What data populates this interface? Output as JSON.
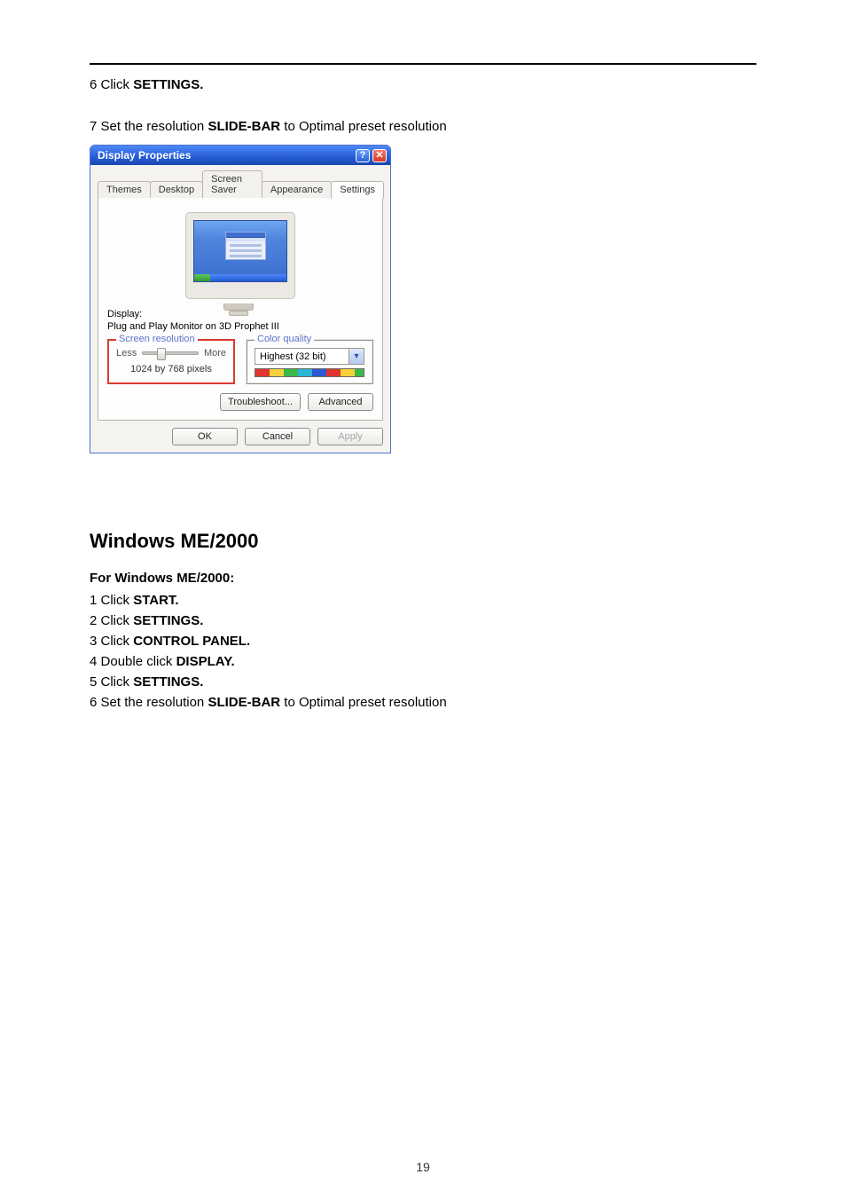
{
  "step6": {
    "num": "6",
    "pre": "Click ",
    "bold": "SETTINGS."
  },
  "step7": {
    "num": "7",
    "pre": "Set the resolution ",
    "bold": "SLIDE-BAR",
    "post": " to Optimal preset resolution"
  },
  "dp": {
    "title": "Display Properties",
    "tabs": [
      "Themes",
      "Desktop",
      "Screen Saver",
      "Appearance",
      "Settings"
    ],
    "active_tab": 4,
    "display_label": "Display:",
    "display_name": "Plug and Play Monitor on 3D Prophet III",
    "resolution": {
      "title": "Screen resolution",
      "less": "Less",
      "more": "More",
      "value": "1024 by 768 pixels"
    },
    "color": {
      "title": "Color quality",
      "value": "Highest (32 bit)"
    },
    "btn_troubleshoot": "Troubleshoot...",
    "btn_advanced": "Advanced",
    "btn_ok": "OK",
    "btn_cancel": "Cancel",
    "btn_apply": "Apply",
    "help_glyph": "?",
    "close_glyph": "✕",
    "dd_glyph": "▾"
  },
  "heading": "Windows ME/2000",
  "subheading": "For Windows ME/2000:",
  "list": {
    "s1": {
      "num": "1",
      "pre": "Click ",
      "bold": "START."
    },
    "s2": {
      "num": "2",
      "pre": "Click ",
      "bold": "SETTINGS."
    },
    "s3": {
      "num": "3",
      "pre": "Click ",
      "bold": "CONTROL PANEL."
    },
    "s4": {
      "num": "4",
      "pre": "Double click ",
      "bold": "DISPLAY."
    },
    "s5": {
      "num": "5",
      "pre": "Click ",
      "bold": "SETTINGS."
    },
    "s6": {
      "num": "6",
      "pre": "Set the resolution ",
      "bold": "SLIDE-BAR",
      "post": " to  Optimal preset resolution"
    }
  },
  "page_number": "19"
}
